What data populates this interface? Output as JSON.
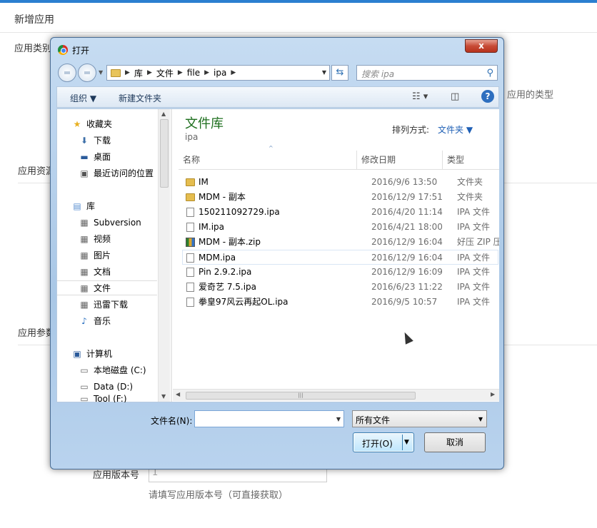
{
  "page": {
    "title": "新增应用",
    "label_app_type": "应用类别",
    "hint_app_type": "应用的类型",
    "label_resource": "应用资源",
    "label_params": "应用参数",
    "label_version": "应用版本号",
    "version_value": "1",
    "version_hint": "请填写应用版本号（可直接获取）"
  },
  "dialog": {
    "title": "打开",
    "close_label": "x",
    "breadcrumb": [
      "库",
      "文件",
      "file",
      "ipa"
    ],
    "search_placeholder": "搜索 ipa",
    "toolbar": {
      "organize": "组织 ▼",
      "new_folder": "新建文件夹"
    },
    "nav": {
      "favorites_header": "收藏夹",
      "favorites": [
        "下载",
        "桌面",
        "最近访问的位置"
      ],
      "libraries_header": "库",
      "libraries": [
        "Subversion",
        "视频",
        "图片",
        "文档",
        "文件",
        "迅雷下载",
        "音乐"
      ],
      "computer_header": "计算机",
      "drives": [
        "本地磁盘 (C:)",
        "Data (D:)",
        "Tool (F:)"
      ]
    },
    "library": {
      "title": "文件库",
      "subtitle": "ipa",
      "arrange_label": "排列方式:",
      "arrange_value": "文件夹 ▼"
    },
    "columns": {
      "name": "名称",
      "modified": "修改日期",
      "type": "类型"
    },
    "files": [
      {
        "name": "IM",
        "date": "2016/9/6 13:50",
        "type": "文件夹",
        "icon": "folder"
      },
      {
        "name": "MDM - 副本",
        "date": "2016/12/9 17:51",
        "type": "文件夹",
        "icon": "folder"
      },
      {
        "name": "150211092729.ipa",
        "date": "2016/4/20 11:14",
        "type": "IPA 文件",
        "icon": "doc"
      },
      {
        "name": "IM.ipa",
        "date": "2016/4/21 18:00",
        "type": "IPA 文件",
        "icon": "doc"
      },
      {
        "name": "MDM - 副本.zip",
        "date": "2016/12/9 16:04",
        "type": "好压 ZIP 压",
        "icon": "zip"
      },
      {
        "name": "MDM.ipa",
        "date": "2016/12/9 16:04",
        "type": "IPA 文件",
        "icon": "doc"
      },
      {
        "name": "Pin 2.9.2.ipa",
        "date": "2016/12/9 16:09",
        "type": "IPA 文件",
        "icon": "doc"
      },
      {
        "name": "爱奇艺 7.5.ipa",
        "date": "2016/6/23 11:22",
        "type": "IPA 文件",
        "icon": "doc"
      },
      {
        "name": "拳皇97风云再起OL.ipa",
        "date": "2016/9/5 10:57",
        "type": "IPA 文件",
        "icon": "doc"
      }
    ],
    "filename_label": "文件名(N):",
    "filename_value": "",
    "filetype_value": "所有文件",
    "open_label": "打开(O)",
    "cancel_label": "取消"
  }
}
